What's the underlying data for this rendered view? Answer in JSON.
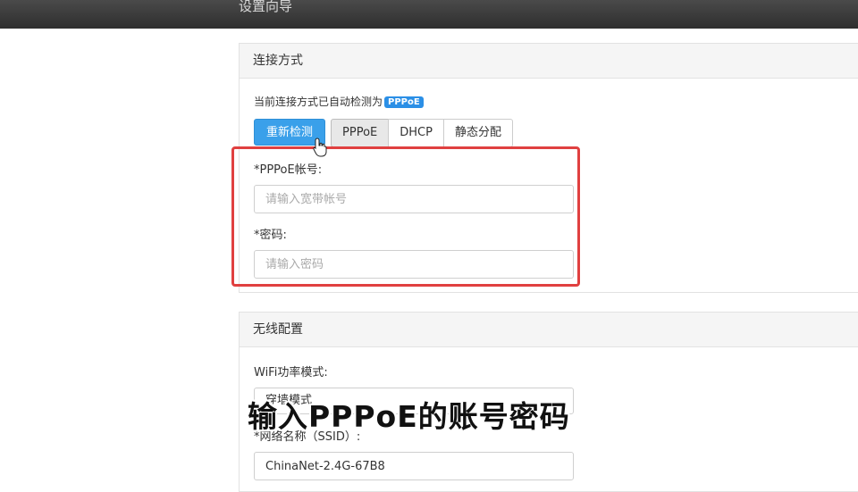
{
  "header": {
    "title": "设置向导"
  },
  "connection": {
    "title": "连接方式",
    "detect_text": "当前连接方式已自动检测为",
    "detected_badge": "PPPoE",
    "redetect_label": "重新检测",
    "tabs": [
      "PPPoE",
      "DHCP",
      "静态分配"
    ],
    "active_tab": "PPPoE",
    "account_label": "*PPPoE帐号:",
    "account_placeholder": "请输入宽带帐号",
    "password_label": "*密码:",
    "password_placeholder": "请输入密码"
  },
  "wireless": {
    "title": "无线配置",
    "power_mode_label": "WiFi功率模式:",
    "power_mode_value": "穿墙模式",
    "ssid_label": "*网络名称（SSID）:",
    "ssid_value": "ChinaNet-2.4G-67B8"
  },
  "overlay": {
    "caption": "输入PPPoE的账号密码",
    "highlight_color": "#e04040"
  },
  "colors": {
    "primary": "#3aa0ea",
    "badge": "#2b8fe6",
    "topbar": "#3a3a3a"
  }
}
